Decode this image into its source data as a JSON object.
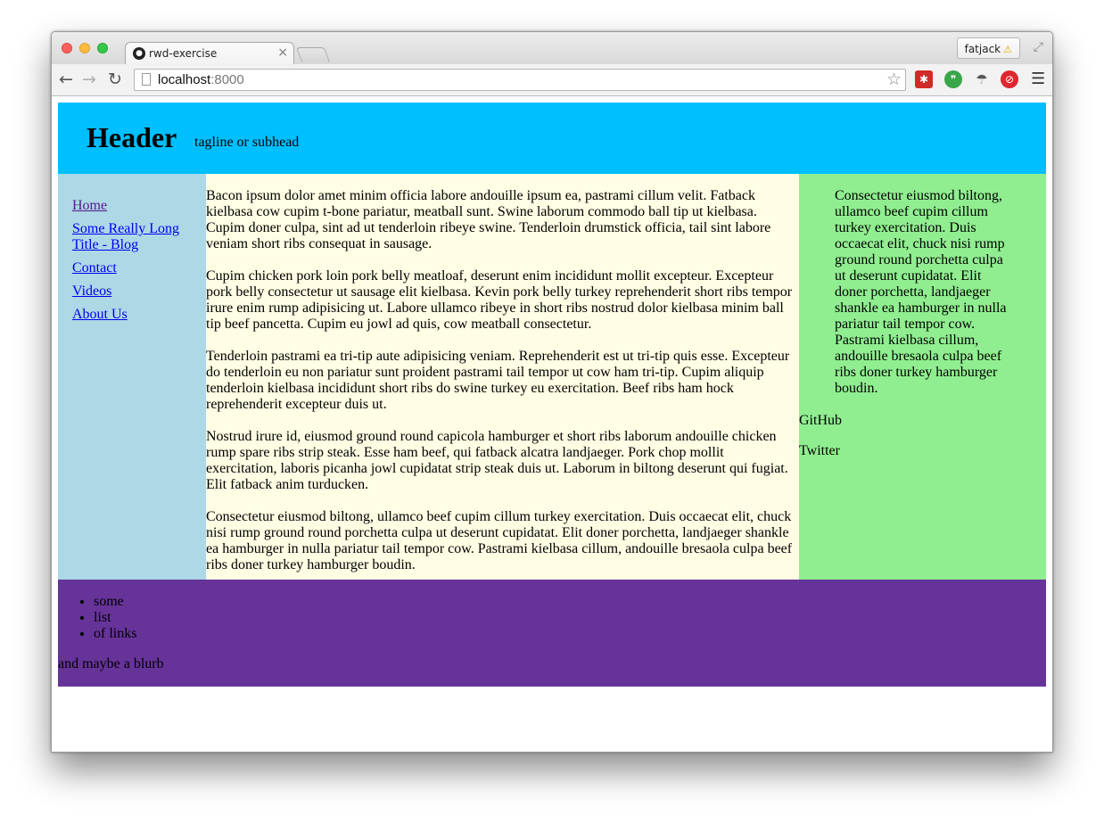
{
  "browser": {
    "tab_title": "rwd-exercise",
    "profile_name": "fatjack",
    "url_host": "localhost",
    "url_port": ":8000"
  },
  "site": {
    "header": {
      "title": "Header",
      "tagline": "tagline or subhead"
    },
    "nav": [
      {
        "label": "Home"
      },
      {
        "label": "Some Really Long Title - Blog"
      },
      {
        "label": "Contact"
      },
      {
        "label": "Videos"
      },
      {
        "label": "About Us"
      }
    ],
    "content": [
      "Bacon ipsum dolor amet minim officia labore andouille ipsum ea, pastrami cillum velit. Fatback kielbasa cow cupim t-bone pariatur, meatball sunt. Swine laborum commodo ball tip ut kielbasa. Cupim doner culpa, sint ad ut tenderloin ribeye swine. Tenderloin drumstick officia, tail sint labore veniam short ribs consequat in sausage.",
      "Cupim chicken pork loin pork belly meatloaf, deserunt enim incididunt mollit excepteur. Excepteur pork belly consectetur ut sausage elit kielbasa. Kevin pork belly turkey reprehenderit short ribs tempor irure enim rump adipisicing ut. Labore ullamco ribeye in short ribs nostrud dolor kielbasa minim ball tip beef pancetta. Cupim eu jowl ad quis, cow meatball consectetur.",
      "Tenderloin pastrami ea tri-tip aute adipisicing veniam. Reprehenderit est ut tri-tip quis esse. Excepteur do tenderloin eu non pariatur sunt proident pastrami tail tempor ut cow ham tri-tip. Cupim aliquip tenderloin kielbasa incididunt short ribs do swine turkey eu exercitation. Beef ribs ham hock reprehenderit excepteur duis ut.",
      "Nostrud irure id, eiusmod ground round capicola hamburger et short ribs laborum andouille chicken rump spare ribs strip steak. Esse ham beef, qui fatback alcatra landjaeger. Pork chop mollit exercitation, laboris picanha jowl cupidatat strip steak duis ut. Laborum in biltong deserunt qui fugiat. Elit fatback anim turducken.",
      "Consectetur eiusmod biltong, ullamco beef cupim cillum turkey exercitation. Duis occaecat elit, chuck nisi rump ground round porchetta culpa ut deserunt cupidatat. Elit doner porchetta, landjaeger shankle ea hamburger in nulla pariatur tail tempor cow. Pastrami kielbasa cillum, andouille bresaola culpa beef ribs doner turkey hamburger boudin."
    ],
    "aside": {
      "quote": "Consectetur eiusmod biltong, ullamco beef cupim cillum turkey exercitation. Duis occaecat elit, chuck nisi rump ground round porchetta culpa ut deserunt cupidatat. Elit doner porchetta, landjaeger shankle ea hamburger in nulla pariatur tail tempor cow. Pastrami kielbasa cillum, andouille bresaola culpa beef ribs doner turkey hamburger boudin.",
      "links": [
        {
          "label": "GitHub"
        },
        {
          "label": "Twitter"
        }
      ]
    },
    "footer": {
      "list": [
        "some",
        "list",
        "of links"
      ],
      "blurb": "and maybe a blurb"
    }
  },
  "colors": {
    "header_bg": "#00bfff",
    "nav_bg": "#add8e6",
    "content_bg": "#fffde3",
    "aside_bg": "#90ee90",
    "footer_bg": "#663399"
  }
}
